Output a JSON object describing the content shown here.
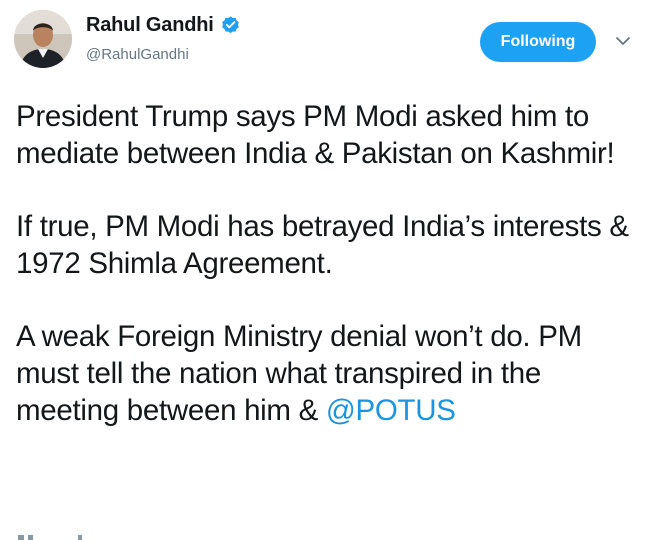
{
  "author": {
    "display_name": "Rahul Gandhi",
    "handle": "@RahulGandhi",
    "verified_icon": "verified-badge-icon",
    "avatar": "avatar"
  },
  "actions": {
    "follow_label": "Following",
    "caret_icon": "chevron-down-icon"
  },
  "tweet": {
    "paragraph_1": "President Trump says PM Modi asked him to mediate between India & Pakistan on Kashmir!",
    "paragraph_2": "If true, PM Modi has betrayed India’s interests & 1972 Shimla Agreement.",
    "paragraph_3_text": "A weak Foreign Ministry denial won’t do. PM must tell the nation what transpired in the meeting between him & ",
    "paragraph_3_mention": "@POTUS"
  },
  "colors": {
    "accent": "#1da1f2",
    "mention": "#1b95e0",
    "text": "#14171a",
    "secondary_text": "#657786"
  }
}
